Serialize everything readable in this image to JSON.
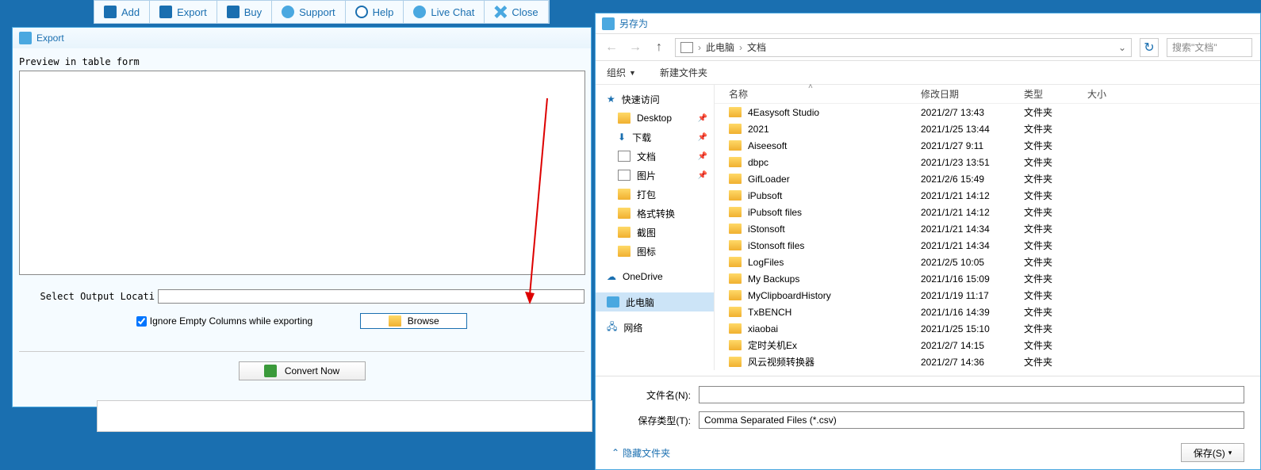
{
  "toolbar": {
    "add": "Add",
    "export": "Export",
    "buy": "Buy",
    "support": "Support",
    "help": "Help",
    "livechat": "Live Chat",
    "close": "Close"
  },
  "export_win": {
    "title": "Export",
    "preview_label": "Preview in table form",
    "output_label": "Select Output Locati",
    "ignore_label": "Ignore Empty Columns while exporting",
    "browse": "Browse",
    "convert": "Convert Now"
  },
  "save": {
    "title": "另存为",
    "bc_pc": "此电脑",
    "bc_docs": "文档",
    "search_ph": "搜索\"文档\"",
    "organize": "组织",
    "new_folder": "新建文件夹",
    "filename_label": "文件名(N):",
    "filename_value": "",
    "filetype_label": "保存类型(T):",
    "filetype_value": "Comma Separated Files (*.csv)",
    "hide_folders": "隐藏文件夹",
    "save_btn": "保存(S)",
    "cols": {
      "name": "名称",
      "date": "修改日期",
      "type": "类型",
      "size": "大小"
    },
    "sidebar": {
      "quick": "快速访问",
      "desktop": "Desktop",
      "downloads": "下载",
      "docs": "文档",
      "pics": "图片",
      "pack": "打包",
      "convert": "格式转换",
      "shot": "截图",
      "icon": "图标",
      "onedrive": "OneDrive",
      "thispc": "此电脑",
      "network": "网络"
    },
    "files": [
      {
        "n": "4Easysoft Studio",
        "d": "2021/2/7 13:43",
        "t": "文件夹"
      },
      {
        "n": "2021",
        "d": "2021/1/25 13:44",
        "t": "文件夹"
      },
      {
        "n": "Aiseesoft",
        "d": "2021/1/27 9:11",
        "t": "文件夹"
      },
      {
        "n": "dbpc",
        "d": "2021/1/23 13:51",
        "t": "文件夹"
      },
      {
        "n": "GifLoader",
        "d": "2021/2/6 15:49",
        "t": "文件夹"
      },
      {
        "n": "iPubsoft",
        "d": "2021/1/21 14:12",
        "t": "文件夹"
      },
      {
        "n": "iPubsoft files",
        "d": "2021/1/21 14:12",
        "t": "文件夹"
      },
      {
        "n": "iStonsoft",
        "d": "2021/1/21 14:34",
        "t": "文件夹"
      },
      {
        "n": "iStonsoft files",
        "d": "2021/1/21 14:34",
        "t": "文件夹"
      },
      {
        "n": "LogFiles",
        "d": "2021/2/5 10:05",
        "t": "文件夹"
      },
      {
        "n": "My Backups",
        "d": "2021/1/16 15:09",
        "t": "文件夹"
      },
      {
        "n": "MyClipboardHistory",
        "d": "2021/1/19 11:17",
        "t": "文件夹"
      },
      {
        "n": "TxBENCH",
        "d": "2021/1/16 14:39",
        "t": "文件夹"
      },
      {
        "n": "xiaobai",
        "d": "2021/1/25 15:10",
        "t": "文件夹"
      },
      {
        "n": "定时关机Ex",
        "d": "2021/2/7 14:15",
        "t": "文件夹"
      },
      {
        "n": "风云视频转换器",
        "d": "2021/2/7 14:36",
        "t": "文件夹"
      }
    ]
  }
}
